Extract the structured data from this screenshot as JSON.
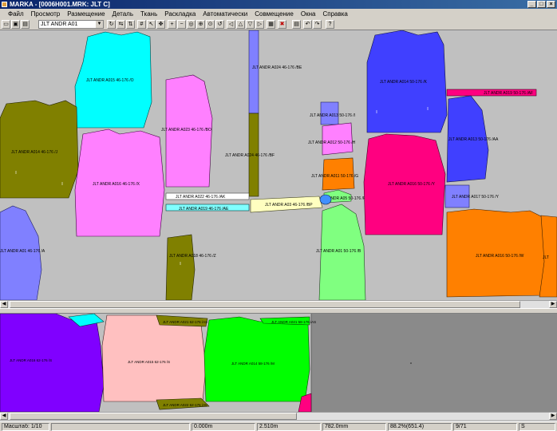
{
  "window": {
    "title": "MARKA - [0006H001.MRK: JLT C]"
  },
  "menu": [
    "Файл",
    "Просмотр",
    "Размещение",
    "Деталь",
    "Ткань",
    "Раскладка",
    "Автоматически",
    "Совмещение",
    "Окна",
    "Справка"
  ],
  "toolbar": {
    "piece_select": "JLT ANDR A01"
  },
  "pieces_top": [
    {
      "label": "JLT ANDR A015 46-176 /O",
      "color": "#00ffff"
    },
    {
      "label": "JLT ANDR A023 46-176 /BO",
      "color": "#ff80ff"
    },
    {
      "label": "JLT ANDR A024 46-176 /BE",
      "color": "#8080ff"
    },
    {
      "label": "JLT ANDR A024 46-176 /BF",
      "color": "#808000"
    },
    {
      "label": "JLT ANDR A014 46-176 /J",
      "color": "#808000"
    },
    {
      "label": "JLT ANDR A016 46-176 /X",
      "color": "#ff80ff"
    },
    {
      "label": "JLT ANDR A022 46-176 /AK",
      "color": "#ffffff"
    },
    {
      "label": "JLT ANDR A019 46-176 /AE",
      "color": "#80ffff"
    },
    {
      "label": "JLT ANDR A018 46-176 /Z",
      "color": "#808000"
    },
    {
      "label": "JLT ANDR A01 46-176 /A",
      "color": "#8080ff"
    },
    {
      "label": "JLT ANDR A03 46-176 /BP",
      "color": "#ffffc0"
    },
    {
      "label": "JLT ANDR A013 50-176 /I",
      "color": "#8080ff"
    },
    {
      "label": "JLT ANDR A012 50-176 /H",
      "color": "#ff80ff"
    },
    {
      "label": "JLT ANDR A011 50-176 /G",
      "color": "#ff8000"
    },
    {
      "label": "JLT ANDR A05 50-176 /F",
      "color": "#80ff80"
    },
    {
      "label": "JLT ANDR A01 50-176 /B",
      "color": "#80ff80"
    },
    {
      "label": "JLT ANDR A014 50-176 /K",
      "color": "#4040ff"
    },
    {
      "label": "JLT ANDR A019 50-176 /AF",
      "color": "#ff0080"
    },
    {
      "label": "JLT ANDR A013 50-176 /AA",
      "color": "#4040ff"
    },
    {
      "label": "JLT ANDR A016 50-176 /Y",
      "color": "#ff0080"
    },
    {
      "label": "JLT ANDR A017 50-176 /Y",
      "color": "#8080ff"
    },
    {
      "label": "JLT ANDR A016 50-176 /W",
      "color": "#ff8000"
    },
    {
      "label": "JLT",
      "color": "#ff8000"
    }
  ],
  "pieces_bottom": [
    {
      "label": "JLT ANDR A016 62-176 /S",
      "color": "#8000ff"
    },
    {
      "label": "JLT ANDR A015 62-176 /S",
      "color": "#ffc0c0"
    },
    {
      "label": "JLT ANDR A021 62-176 /AS",
      "color": "#808000"
    },
    {
      "label": "JLT ANDR A014 58-176 /M",
      "color": "#00ff00"
    },
    {
      "label": "JLT ANDR A021 58-176 /AS",
      "color": "#00ff00"
    },
    {
      "label": "JLT ANDR A022 62-176 /AV",
      "color": "#808000"
    }
  ],
  "status": {
    "scale": "Масштаб: 1/10",
    "pos1": "0.000m",
    "pos2": "2.510m",
    "pos3": "782.0mm",
    "efficiency": "88.2%(651.4)",
    "count": "9/71",
    "mode": "S"
  }
}
